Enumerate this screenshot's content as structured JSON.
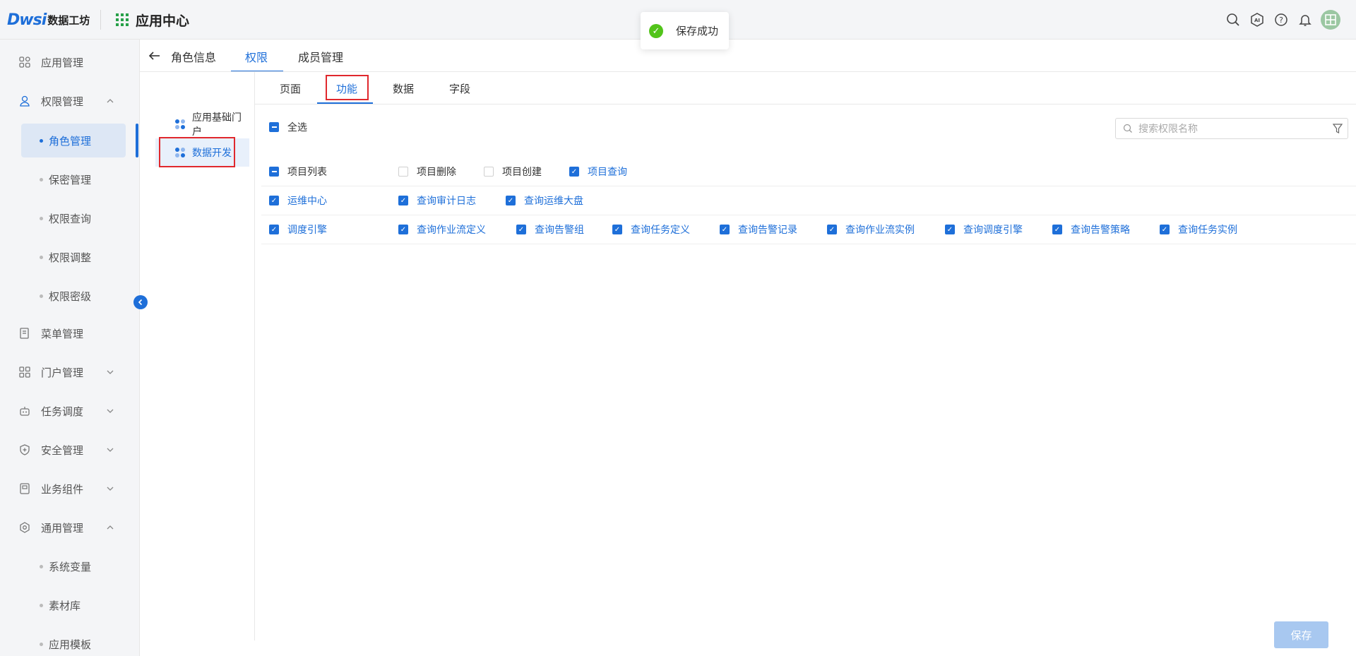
{
  "header": {
    "logo_mark": "Dws",
    "logo_mark_i": "i",
    "logo_text": "数据工坊",
    "app_title": "应用中心"
  },
  "toast": {
    "message": "保存成功"
  },
  "sidebar": {
    "items": [
      {
        "label": "应用管理",
        "icon": "apps-icon"
      },
      {
        "label": "权限管理",
        "icon": "user-lock-icon",
        "expanded": true
      },
      {
        "label": "菜单管理",
        "icon": "menu-doc-icon"
      },
      {
        "label": "门户管理",
        "icon": "portal-icon",
        "expanded": false
      },
      {
        "label": "任务调度",
        "icon": "robot-icon",
        "expanded": false
      },
      {
        "label": "安全管理",
        "icon": "shield-icon",
        "expanded": false
      },
      {
        "label": "业务组件",
        "icon": "component-icon",
        "expanded": false
      },
      {
        "label": "通用管理",
        "icon": "settings-icon",
        "expanded": true
      }
    ],
    "permission_sub": [
      "角色管理",
      "保密管理",
      "权限查询",
      "权限调整",
      "权限密级"
    ],
    "general_sub": [
      "系统变量",
      "素材库",
      "应用模板"
    ]
  },
  "top_tabs": [
    "角色信息",
    "权限",
    "成员管理"
  ],
  "tree": [
    "应用基础门户",
    "数据开发"
  ],
  "sub_tabs": [
    "页面",
    "功能",
    "数据",
    "字段"
  ],
  "select_all": "全选",
  "search": {
    "placeholder": "搜索权限名称"
  },
  "permissions": [
    {
      "group": "项目列表",
      "state": "indeterminate",
      "items": [
        {
          "label": "项目删除",
          "checked": false
        },
        {
          "label": "项目创建",
          "checked": false
        },
        {
          "label": "项目查询",
          "checked": true
        }
      ]
    },
    {
      "group": "运维中心",
      "state": "checked",
      "items": [
        {
          "label": "查询审计日志",
          "checked": true
        },
        {
          "label": "查询运维大盘",
          "checked": true
        }
      ]
    },
    {
      "group": "调度引擎",
      "state": "checked",
      "items": [
        {
          "label": "查询作业流定义",
          "checked": true
        },
        {
          "label": "查询告警组",
          "checked": true
        },
        {
          "label": "查询任务定义",
          "checked": true
        },
        {
          "label": "查询告警记录",
          "checked": true
        },
        {
          "label": "查询作业流实例",
          "checked": true
        },
        {
          "label": "查询调度引擎",
          "checked": true
        },
        {
          "label": "查询告警策略",
          "checked": true
        },
        {
          "label": "查询任务实例",
          "checked": true
        }
      ]
    }
  ],
  "save_label": "保存",
  "colors": {
    "primary": "#1e6fd9",
    "success": "#52c41a",
    "highlight_box": "#e0282d"
  }
}
